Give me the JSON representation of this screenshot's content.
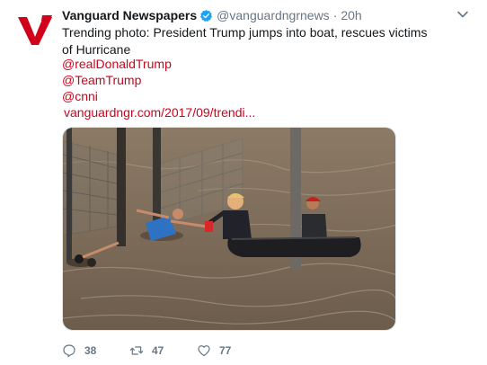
{
  "tweet": {
    "display_name": "Vanguard Newspapers",
    "handle": "@vanguardngrnews",
    "separator": "·",
    "time": "20h",
    "text": "Trending photo: President Trump jumps into boat, rescues victims of Hurricane",
    "mentions": [
      "@realDonaldTrump",
      "@TeamTrump",
      "@cnni"
    ],
    "link": "vanguardngr.com/2017/09/trendi...",
    "avatar_icon": "vanguard-v-logo",
    "accent_color": "#d0021b",
    "verified_color": "#1da1f2",
    "photo": {
      "subject": "flood-rescue-photo"
    },
    "actions": {
      "reply_count": "38",
      "retweet_count": "47",
      "like_count": "77"
    }
  }
}
